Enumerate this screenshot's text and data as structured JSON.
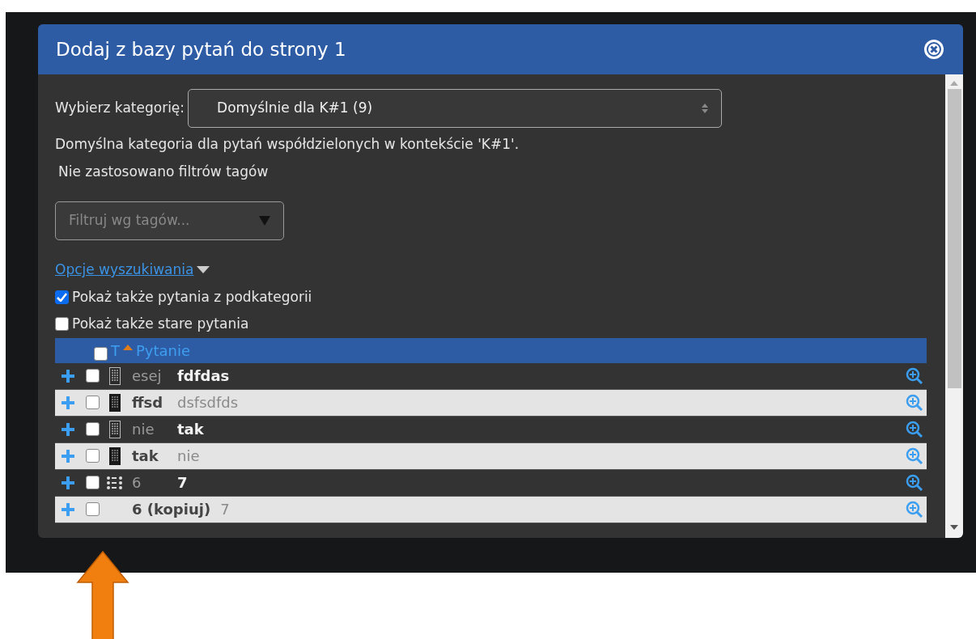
{
  "dialog": {
    "title": "Dodaj z bazy pytań do strony 1"
  },
  "category": {
    "label": "Wybierz kategorię:",
    "value": "Domyślnie dla K#1 (9)"
  },
  "category_description": "Domyślna kategoria dla pytań współdzielonych w kontekście 'K#1'.",
  "tag_status": "Nie zastosowano filtrów tagów",
  "tag_filter": {
    "placeholder": "Filtruj wg tagów..."
  },
  "search_options_link": "Opcje wyszukiwania",
  "options": [
    {
      "label": "Pokaż także pytania z podkategorii",
      "checked": true
    },
    {
      "label": "Pokaż także stare pytania",
      "checked": false
    }
  ],
  "table": {
    "columns": [
      "T",
      "Pytanie"
    ],
    "select_all_checked": false,
    "rows": [
      {
        "kind": "essay",
        "name": "esej",
        "text": "fdfdas",
        "checked": false
      },
      {
        "kind": "essay",
        "name": "ffsd",
        "text": "dsfsdfds",
        "checked": false
      },
      {
        "kind": "essay",
        "name": "nie",
        "text": "tak",
        "checked": false
      },
      {
        "kind": "essay",
        "name": "tak",
        "text": "nie",
        "checked": false
      },
      {
        "kind": "list",
        "name": "6",
        "text": "7",
        "checked": false
      },
      {
        "kind": "none",
        "name": "6 (kopiuj)",
        "text": "7",
        "checked": false
      }
    ]
  }
}
